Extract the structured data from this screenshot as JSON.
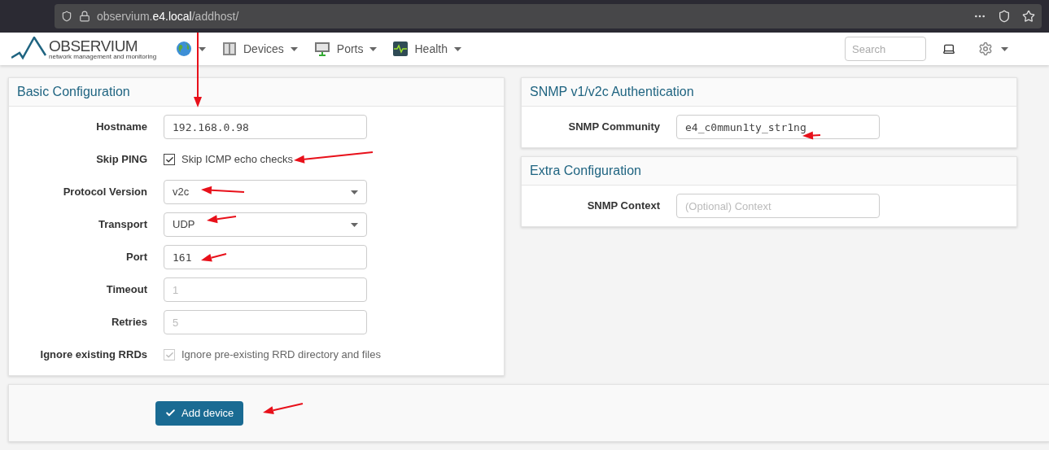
{
  "browser": {
    "url_prefix": "observium.",
    "url_domain": "e4.local",
    "url_path": "/addhost/"
  },
  "navbar": {
    "logo": "OBSERVIUM",
    "logo_tagline": "network management and monitoring",
    "menus": [
      {
        "kind": "globe"
      },
      {
        "label": "Devices",
        "kind": "devices"
      },
      {
        "label": "Ports",
        "kind": "ports"
      },
      {
        "label": "Health",
        "kind": "health"
      }
    ],
    "search": {
      "placeholder": "Search"
    }
  },
  "basic": {
    "title": "Basic Configuration",
    "fields": [
      {
        "kind": "text",
        "label": "Hostname",
        "value": "192.168.0.98"
      },
      {
        "kind": "checkbox",
        "label": "Skip PING",
        "text": "Skip ICMP echo checks",
        "checked": true,
        "disabled": false
      },
      {
        "kind": "select",
        "label": "Protocol Version",
        "value": "v2c"
      },
      {
        "kind": "select",
        "label": "Transport",
        "value": "UDP"
      },
      {
        "kind": "text",
        "label": "Port",
        "value": "161"
      },
      {
        "kind": "text",
        "label": "Timeout",
        "placeholder": "1"
      },
      {
        "kind": "text",
        "label": "Retries",
        "placeholder": "5"
      },
      {
        "kind": "checkbox",
        "label": "Ignore existing RRDs",
        "text": "Ignore pre-existing RRD directory and files",
        "checked": true,
        "disabled": true
      }
    ]
  },
  "snmp": {
    "title": "SNMP v1/v2c Authentication",
    "fields": [
      {
        "kind": "text",
        "label": "SNMP Community",
        "value": "e4_c0mmun1ty_str1ng"
      }
    ]
  },
  "extra": {
    "title": "Extra Configuration",
    "fields": [
      {
        "kind": "text",
        "label": "SNMP Context",
        "placeholder": "(Optional) Context"
      }
    ]
  },
  "submit": {
    "label": "Add device"
  }
}
